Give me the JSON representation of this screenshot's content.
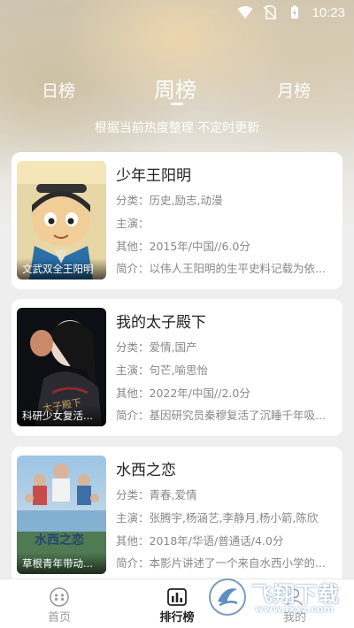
{
  "status": {
    "time": "10:23"
  },
  "tabs": {
    "day": "日榜",
    "week": "周榜",
    "month": "月榜",
    "active": "week"
  },
  "subtitle": "根据当前热度整理 不定时更新",
  "cards": [
    {
      "title": "少年王阳明",
      "poster_caption": "文武双全王阳明",
      "genre": "分类：历史,励志,动漫",
      "cast": "主演：",
      "other": "其他：2015年/中国//6.0分",
      "intro": "简介：以伟人王阳明的生平史料记载为依..."
    },
    {
      "title": "我的太子殿下",
      "poster_caption": "科研少女复活...",
      "genre": "分类：爱情,国产",
      "cast": "主演：句芒,喻思怡",
      "other": "其他：2022年/中国//2.0分",
      "intro": "简介：基因研究员秦穆复活了沉睡千年吸..."
    },
    {
      "title": "水西之恋",
      "poster_caption": "草根青年带动...",
      "genre": "分类：青春,爱情",
      "cast": "主演：张腾宇,杨涵艺,李静月,杨小箭,陈欣",
      "other": "其他：2018年/华语/普通话/4.0分",
      "intro": "简介：本影片讲述了一个来自水西小学的..."
    }
  ],
  "bottom_nav": {
    "home": "首页",
    "rank": "排行榜",
    "mine": "我的"
  },
  "watermark": {
    "text": "飞翔下载",
    "url": "www.fxxz.com"
  }
}
